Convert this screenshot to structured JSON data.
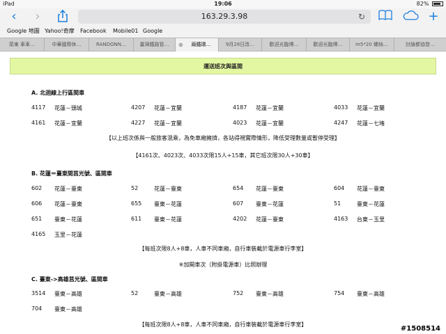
{
  "status": {
    "device": "iPad",
    "time": "19:06",
    "battery": "82%",
    "battery_level": 0.82
  },
  "toolbar": {
    "back_icon": "chevron-left-icon",
    "forward_icon": "chevron-right-icon",
    "share_icon": "share-icon",
    "url": "163.29.3.98",
    "reload_icon": "reload-icon",
    "reading_icon": "book-icon",
    "cloud_icon": "cloud-icon",
    "new_tab_icon": "plus-icon"
  },
  "bookmarks": [
    "Google 地圖",
    "Yahoo!奇摩",
    "Facebook",
    "Mobile01",
    "Google"
  ],
  "tabs": [
    "菜東 車車…",
    "中華國際休…",
    "RANDONN…",
    "臺灣鐵路管…",
    "兩鐵環…",
    "9月28日改…",
    "歡迎光臨博…",
    "歡迎光臨博…",
    "m5*20 螺絲…",
    "討論都協發…"
  ],
  "page": {
    "banner": "運送班次與區間",
    "sectionA": {
      "title": "A. 北迴線上行區間車",
      "rows": [
        [
          "4117",
          "花蓮－頭城",
          "4207",
          "花蓮－宜蘭",
          "4187",
          "花蓮－宜蘭",
          "4033",
          "花蓮－宜蘭"
        ],
        [
          "4161",
          "花蓮－宜蘭",
          "4227",
          "花蓮－宜蘭",
          "4023",
          "花蓮－宜蘭",
          "4247",
          "花蓮－七堵"
        ]
      ],
      "note1": "【以上班次係與一般旅客混乘，為免車廂擁擠，各站得視實際情形，降低受理數量或暫停受理】",
      "note2": "【4161次、4023次、4033次限15人+15車，其它班次限30人+30車】"
    },
    "sectionB": {
      "title": "B. 花蓮＝臺東間莒光號、區間車",
      "rows": [
        [
          "602",
          "花蓮－臺東",
          "52",
          "花蓮－臺東",
          "654",
          "花蓮－臺東",
          "604",
          "花蓮－臺東"
        ],
        [
          "606",
          "花蓮－臺東",
          "655",
          "臺東－花蓮",
          "607",
          "臺東－花蓮",
          "51",
          "臺東－花蓮"
        ],
        [
          "651",
          "臺東－花蓮",
          "611",
          "臺東－花蓮",
          "4202",
          "花蓮－臺東",
          "4163",
          "台東－玉里"
        ],
        [
          "4165",
          "玉里－花蓮",
          "",
          "",
          "",
          "",
          "",
          ""
        ]
      ],
      "note1": "【每班次限8人+8車，人車不同車廂，自行車裝載於電源車行李室】",
      "note2": "※加開車次（附掛電源車）比照辦理"
    },
    "sectionC": {
      "title": "C. 臺東->高雄莒光號、區間車",
      "rows": [
        [
          "3514",
          "臺東－高雄",
          "52",
          "臺東－高雄",
          "752",
          "臺東－高雄",
          "754",
          "臺東－高雄"
        ],
        [
          "704",
          "臺東－高雄",
          "",
          "",
          "",
          "",
          "",
          ""
        ]
      ],
      "note1": "【每班次限8人+8車，人車不同車廂，自行車裝載於電源車行李室】"
    }
  },
  "watermark": "#1508514"
}
